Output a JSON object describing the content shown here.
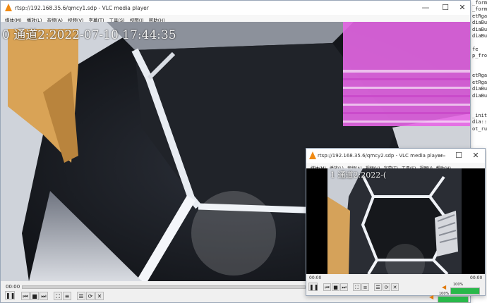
{
  "editor_lines": [
    "_format",
    "_format",
    "etRgaF",
    "diaBuffe",
    "diaBuffe",
    "diaBuffe",
    "",
    "fe",
    "p_from_",
    "",
    "",
    "etRgaF",
    "etRgaF",
    "diaBuffe",
    "diaBuffe",
    "",
    "",
    "_init",
    "dia::get",
    "ot_run",
    "",
    "",
    "",
    "",
    "",
    "",
    "",
    "",
    "",
    "",
    "",
    "",
    "",
    "",
    "",
    "",
    "",
    "",
    "",
    "",
    "",
    "",
    "",
    "",
    "",
    ""
  ],
  "window1": {
    "title": "rtsp://192.168.35.6/qmcy1.sdp - VLC media player",
    "menus": [
      "媒体(M)",
      "播放(L)",
      "音频(A)",
      "视频(V)",
      "字幕(T)",
      "工具(S)",
      "视图(I)",
      "帮助(H)"
    ],
    "osd": "0 通道2:2022-07-10 17:44:35",
    "time_elapsed": "00:00",
    "volume_pct": "100%",
    "volume_level": 1.0,
    "buttons": {
      "minimize": "—",
      "maximize": "☐",
      "close": "✕"
    }
  },
  "window2": {
    "title": "rtsp://192.168.35.6/qmcy2.sdp - VLC media player",
    "menus": [
      "媒体(M)",
      "播放(L)",
      "音频(A)",
      "视频(V)",
      "字幕(T)",
      "工具(S)",
      "视图(I)",
      "帮助(H)"
    ],
    "osd": "1 通道2:2022-(",
    "time_elapsed": "00:00",
    "time_total": "00:00",
    "volume_pct": "100%",
    "volume_level": 1.0,
    "buttons": {
      "minimize": "—",
      "maximize": "☐",
      "close": "✕"
    }
  },
  "controls": {
    "play_pause": "❚❚",
    "prev": "⏮",
    "stop": "■",
    "next": "⏭",
    "fullscreen": "⛶",
    "extended": "≡",
    "playlist": "☰",
    "loop": "⟳",
    "shuffle": "✕"
  },
  "colors": {
    "accent": "#f08a12",
    "volume": "#29b84a",
    "overlay_magenta": "#e060e0"
  }
}
